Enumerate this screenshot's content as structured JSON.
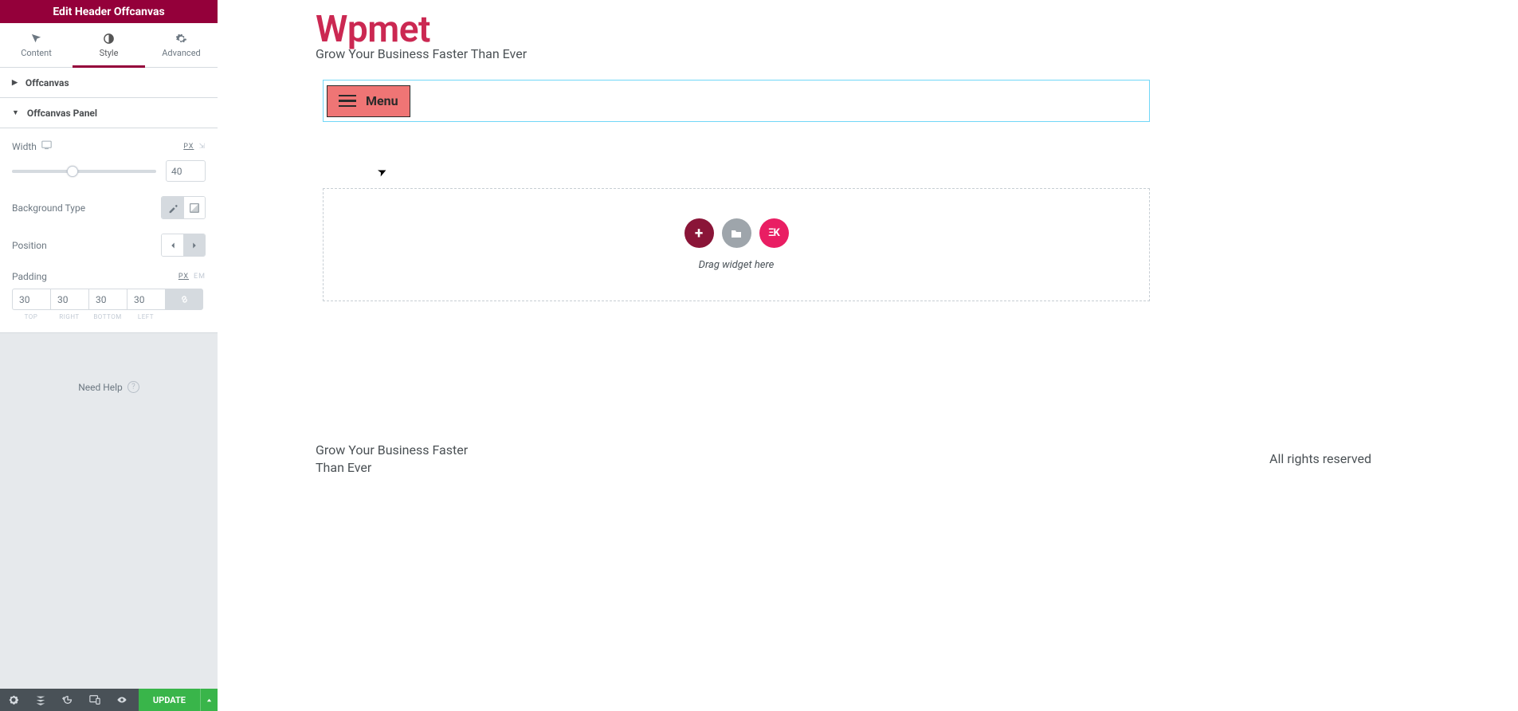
{
  "panel": {
    "title": "Edit Header Offcanvas",
    "tabs": {
      "content": "Content",
      "style": "Style",
      "advanced": "Advanced"
    },
    "section_offcanvas": "Offcanvas",
    "section_offcanvas_panel": "Offcanvas Panel",
    "width": {
      "label": "Width",
      "value": "40",
      "unit_px": "PX",
      "slider_percent": 40
    },
    "bgtype": {
      "label": "Background Type"
    },
    "position": {
      "label": "Position"
    },
    "padding": {
      "label": "Padding",
      "unit_px": "PX",
      "unit_em": "EM",
      "top": "30",
      "right": "30",
      "bottom": "30",
      "left": "30",
      "lbl_top": "TOP",
      "lbl_right": "RIGHT",
      "lbl_bottom": "BOTTOM",
      "lbl_left": "LEFT"
    },
    "help": "Need Help",
    "update": "UPDATE"
  },
  "canvas": {
    "site_title": "Wpmet",
    "site_tagline": "Grow Your Business Faster Than Ever",
    "menu_label": "Menu",
    "drop_hint": "Drag widget here",
    "ek_label": "ΞK",
    "footer_tagline": "Grow Your Business Faster Than Ever",
    "rights": "All rights reserved"
  }
}
